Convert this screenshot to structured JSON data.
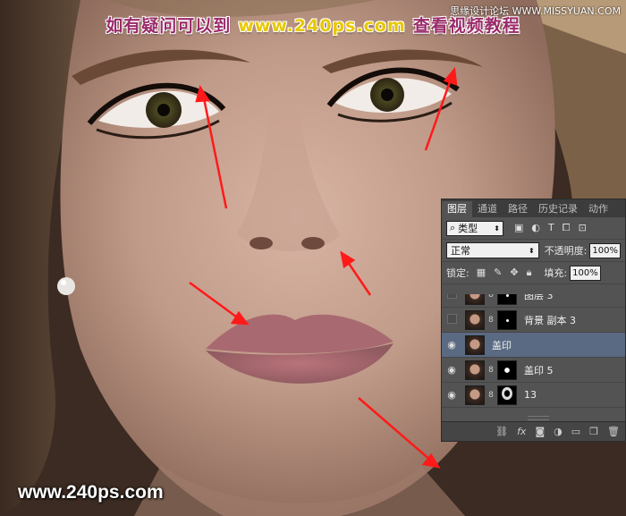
{
  "banner": {
    "left": "如有疑问可以到",
    "site": "www.240ps.com",
    "right": "查看视频教程"
  },
  "corner_logo": "思缘设计论坛 WWW.MISSYUAN.COM",
  "footer_site": "www.240ps.com",
  "colors": {
    "arrow": "#ff1a1a",
    "panel_bg": "#535353",
    "selected_layer": "#596a82"
  },
  "panel": {
    "tabs": [
      "图层",
      "通道",
      "路径",
      "历史记录",
      "动作"
    ],
    "filter": {
      "label": "类型",
      "icons": [
        "image-icon",
        "adjustment-icon",
        "type-icon",
        "shape-icon",
        "smart-object-icon"
      ]
    },
    "blend_mode": "正常",
    "opacity_label": "不透明度:",
    "opacity_value": "100%",
    "lock_label": "锁定:",
    "fill_label": "填充:",
    "fill_value": "100%",
    "layers": [
      {
        "name": "图层 3",
        "visible": false,
        "mask": "dot"
      },
      {
        "name": "背景 副本 3",
        "visible": false,
        "mask": "dot"
      },
      {
        "name": "盖印",
        "visible": true,
        "mask": "none",
        "selected": true
      },
      {
        "name": "盖印 5",
        "visible": true,
        "mask": "face"
      },
      {
        "name": "13",
        "visible": true,
        "mask": "face2"
      }
    ],
    "bottom_icons": [
      "link-icon",
      "fx-icon",
      "add-mask-icon",
      "adjustment-layer-icon",
      "group-icon",
      "new-layer-icon",
      "delete-icon"
    ]
  }
}
